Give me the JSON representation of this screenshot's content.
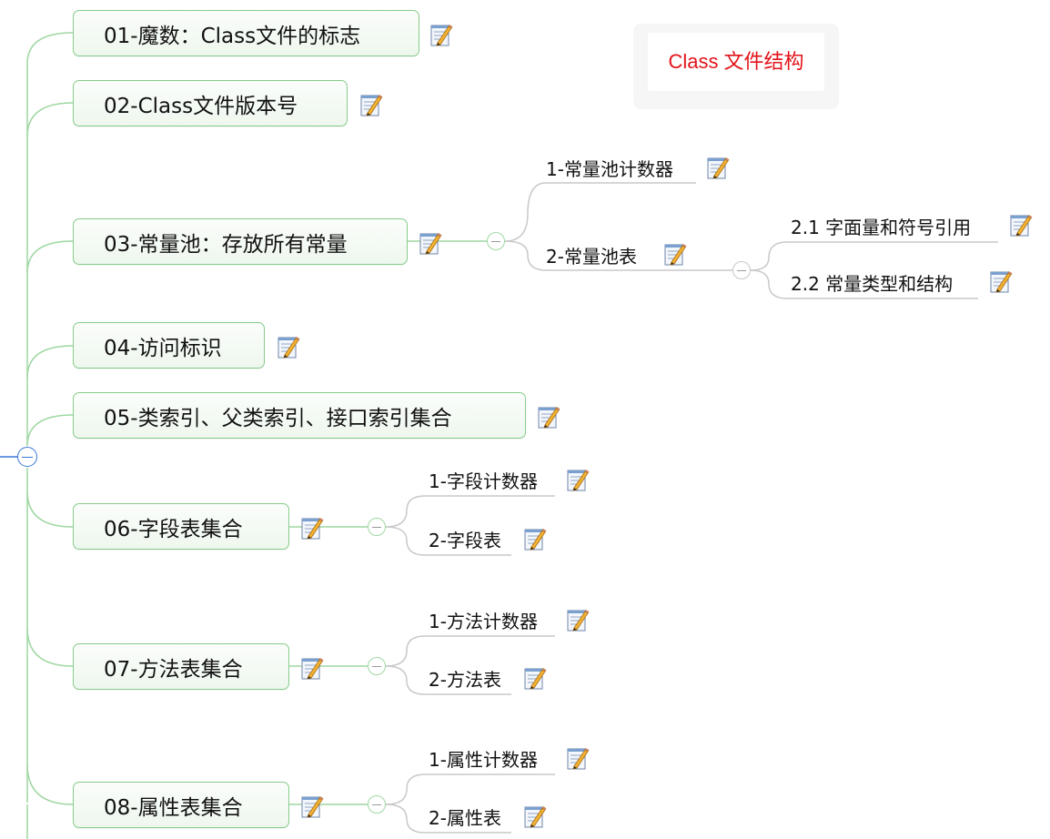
{
  "title": "Class 文件结构",
  "colors": {
    "title": "#e3141a",
    "main_border": "#86cc8a",
    "branch_line": "#9ed7a1",
    "sub_line": "#c9c9c9"
  },
  "nodes": {
    "n1": "01-魔数：Class文件的标志",
    "n2": "02-Class文件版本号",
    "n3": "03-常量池：存放所有常量",
    "n4": "04-访问标识",
    "n5": "05-类索引、父类索引、接口索引集合",
    "n6": "06-字段表集合",
    "n7": "07-方法表集合",
    "n8": "08-属性表集合"
  },
  "children": {
    "c3_1": "1-常量池计数器",
    "c3_2": "2-常量池表",
    "c3_2_1": "2.1 字面量和符号引用",
    "c3_2_2": "2.2 常量类型和结构",
    "c6_1": "1-字段计数器",
    "c6_2": "2-字段表",
    "c7_1": "1-方法计数器",
    "c7_2": "2-方法表",
    "c8_1": "1-属性计数器",
    "c8_2": "2-属性表"
  },
  "icons": {
    "note": "note-icon",
    "collapse": "collapse-icon"
  }
}
